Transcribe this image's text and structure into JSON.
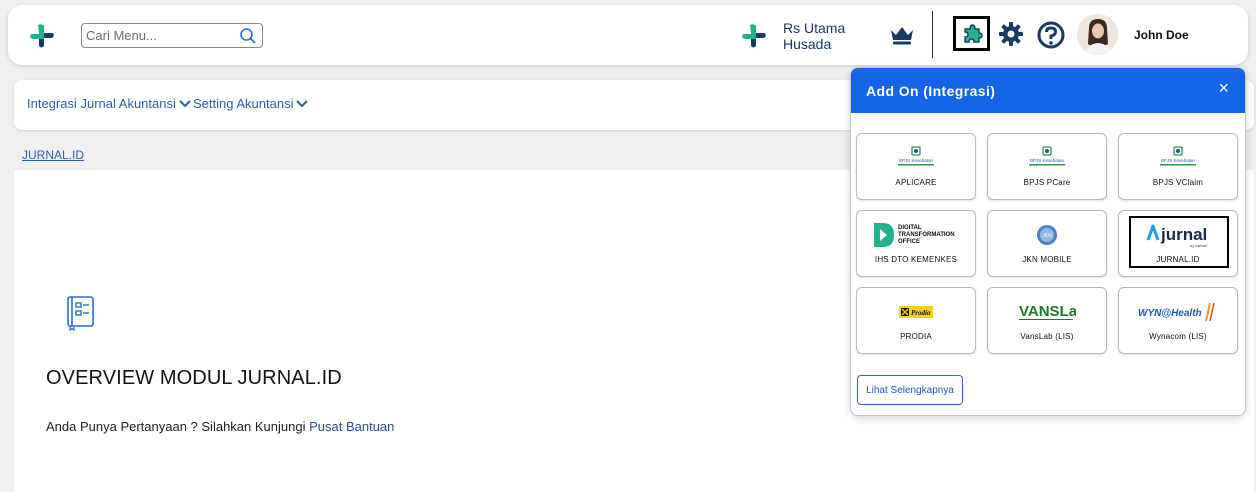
{
  "header": {
    "search_placeholder": "Cari Menu...",
    "hospital_name_line1": "Rs Utama",
    "hospital_name_line2": "Husada",
    "user_name": "John Doe"
  },
  "subnav": {
    "items": [
      {
        "label": "Integrasi Jurnal Akuntansi"
      },
      {
        "label": "Setting Akuntansi"
      }
    ]
  },
  "breadcrumb": "JURNAL.ID",
  "main": {
    "title": "OVERVIEW MODUL JURNAL.ID",
    "question": "Anda Punya Pertanyaan ? Silahkan Kunjungi ",
    "help_link": "Pusat Bantuan"
  },
  "addon_panel": {
    "title": "Add On (Integrasi)",
    "close": "×",
    "tiles": [
      {
        "label": "APLICARE",
        "logo_text": "BPJS Kesehatan",
        "icon": "bpjs-logo"
      },
      {
        "label": "BPJS PCare",
        "logo_text": "BPJS Kesehatan",
        "icon": "bpjs-logo"
      },
      {
        "label": "BPJS VClaim",
        "logo_text": "BPJS Kesehatan",
        "icon": "bpjs-logo"
      },
      {
        "label": "IHS DTO KEMENKES",
        "logo_text": "DIGITAL TRANSFORMATION OFFICE",
        "icon": "dto-logo"
      },
      {
        "label": "JKN MOBILE",
        "logo_text": "",
        "icon": "jkn-logo"
      },
      {
        "label": "JURNAL.ID",
        "logo_text": "jurnal",
        "logo_sub": "by mekari",
        "icon": "jurnal-logo"
      },
      {
        "label": "PRODIA",
        "logo_text": "Prodia",
        "icon": "prodia-logo"
      },
      {
        "label": "VansLab (LIS)",
        "logo_text": "VANSLab",
        "icon": "vanslab-logo"
      },
      {
        "label": "Wynacom (LIS)",
        "logo_text": "WYN@Health",
        "icon": "wynacom-logo"
      }
    ],
    "more_button": "Lihat Selengkapnya"
  },
  "colors": {
    "primary": "#1565e8",
    "brand_green": "#1fb48e",
    "brand_navy": "#1a3a63",
    "link": "#2a5fa8"
  }
}
